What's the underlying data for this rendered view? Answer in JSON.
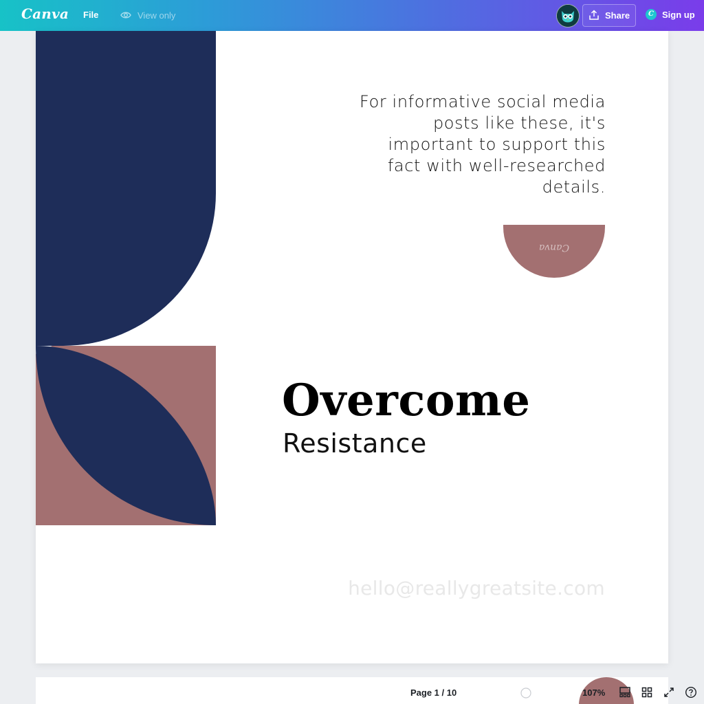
{
  "app": {
    "logo": "Canva",
    "file_label": "File",
    "view_only_label": "View only",
    "share_label": "Share",
    "signup_label": "Sign up",
    "signup_logo_letter": "C"
  },
  "design": {
    "body_lines": [
      "For informative social media",
      "posts like these, it's",
      "important to support this",
      "fact with well-researched",
      "details."
    ],
    "watermark": "Canva",
    "title": "Overcome",
    "subtitle": "Resistance",
    "email": "hello@reallygreatsite.com",
    "colors": {
      "navy": "#1e2d59",
      "mauve": "#a37071"
    }
  },
  "footer": {
    "page_indicator": "Page 1 / 10",
    "zoom": "107%"
  },
  "icons": {
    "eye": "eye-icon",
    "share": "upload-icon",
    "avatar": "owl-avatar",
    "pages": "page-layout-icon",
    "grid": "grid-view-icon",
    "fullscreen": "expand-icon",
    "help": "help-circle-icon"
  }
}
